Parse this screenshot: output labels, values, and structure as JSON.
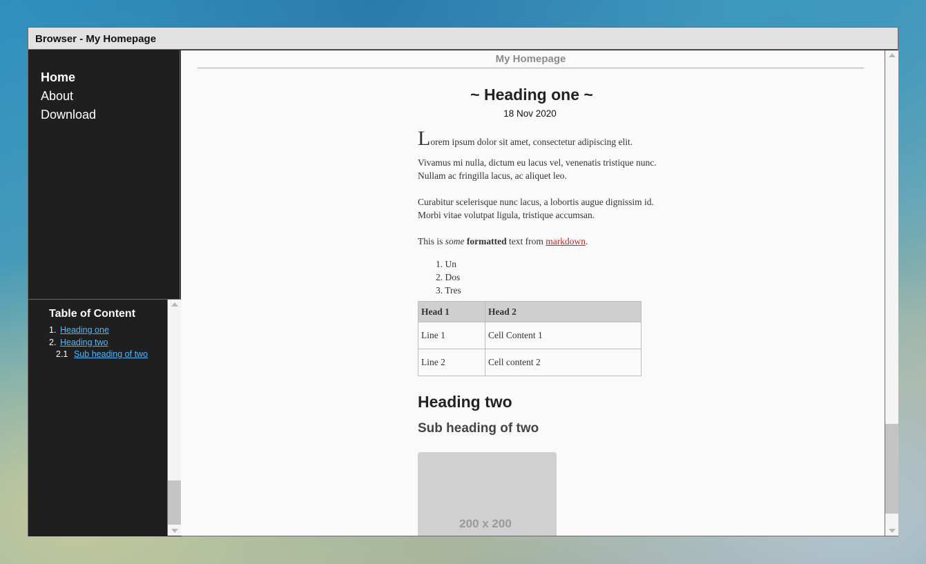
{
  "window": {
    "title": "Browser - My Homepage"
  },
  "nav": {
    "items": [
      "Home",
      "About",
      "Download"
    ],
    "active": "Home"
  },
  "toc": {
    "title": "Table of Content",
    "items": [
      {
        "num": "1.",
        "label": "Heading one"
      },
      {
        "num": "2.",
        "label": "Heading two"
      },
      {
        "num": "2.1",
        "label": "Sub heading of two"
      }
    ]
  },
  "page": {
    "site_title": "My Homepage",
    "heading1": "~ Heading one ~",
    "date": "18 Nov 2020",
    "para1_dropcap": "L",
    "para1_rest": "orem ipsum dolor sit amet, consectetur adipiscing elit.",
    "para2_line1": "Vivamus mi nulla, dictum eu lacus vel, venenatis tristique nunc.",
    "para2_line2": "Nullam ac fringilla lacus, ac aliquet leo.",
    "para3_line1": "Curabitur scelerisque nunc lacus, a lobortis augue dignissim id.",
    "para3_line2": "Morbi vitae volutpat ligula, tristique accumsan.",
    "para4": {
      "prefix": "This is ",
      "italic": "some",
      "bold": "formatted",
      "middle": " text from ",
      "link": "markdown",
      "suffix": "."
    },
    "ordered_list": [
      "Un",
      "Dos",
      "Tres"
    ],
    "table": {
      "headers": [
        "Head 1",
        "Head 2"
      ],
      "rows": [
        [
          "Line 1",
          "Cell Content 1"
        ],
        [
          "Line 2",
          "Cell content 2"
        ]
      ]
    },
    "heading2": "Heading two",
    "subheading": "Sub heading of two",
    "image_placeholder": "200 x 200"
  }
}
